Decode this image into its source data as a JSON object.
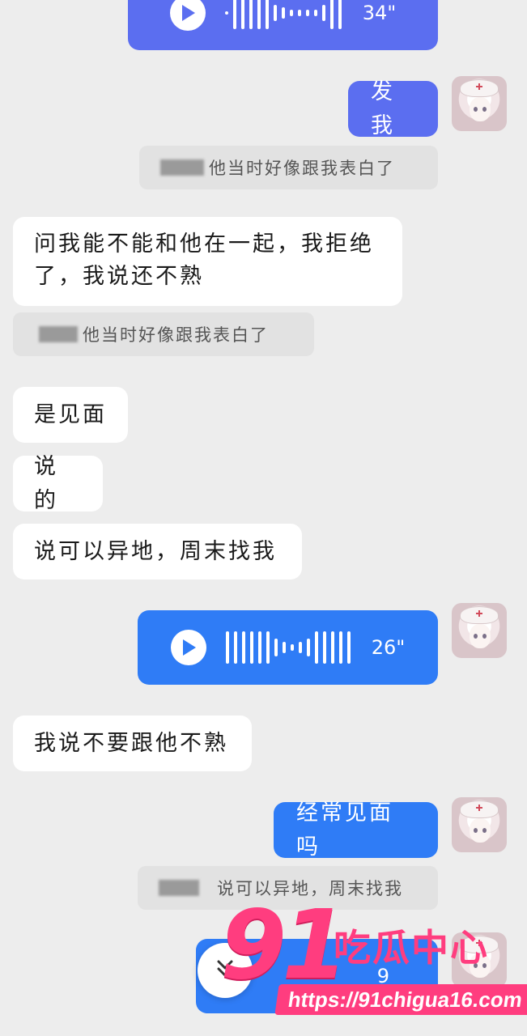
{
  "messages": {
    "m0_voice_duration": "34\"",
    "m1_text": "发我",
    "q1_text": "他当时好像跟我表白了",
    "m2_line1": "问我能不能和他在一起，我拒绝",
    "m2_line2": "了，我说还不熟",
    "q2_text": "他当时好像跟我表白了",
    "m3_text": "是见面",
    "m4_text": "说的",
    "m5_text": "说可以异地，周末找我",
    "m6_voice_duration": "26\"",
    "m7_text": "我说不要跟他不熟",
    "m8_text": "经常见面吗",
    "q3_text": "说可以异地，周末找我",
    "m9_voice_duration_partial": "9"
  },
  "watermark": {
    "number": "91",
    "text": "吃瓜中心",
    "url": "https://91chigua16.com"
  },
  "colors": {
    "background": "#ededed",
    "outgoing_bubble": "#2f7cf6",
    "outgoing_bubble_top": "#5b6ef0",
    "incoming_bubble": "#ffffff",
    "quote_background": "#e2e2e2",
    "watermark": "#ff3d7f"
  },
  "icons": [
    "play-icon",
    "double-chevron-down-icon",
    "avatar"
  ]
}
